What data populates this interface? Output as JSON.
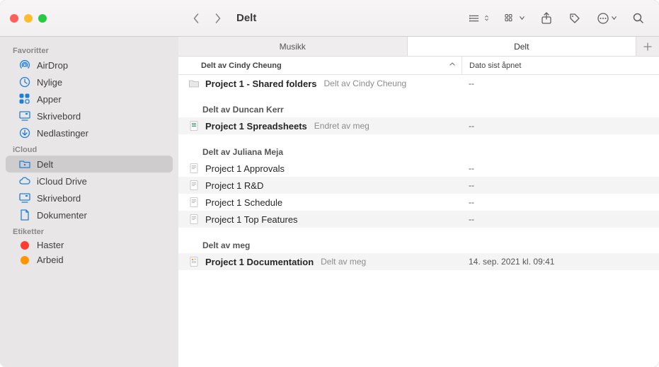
{
  "window_title": "Delt",
  "sidebar": {
    "sections": [
      {
        "header": "Favoritter",
        "items": [
          {
            "icon": "airdrop",
            "label": "AirDrop"
          },
          {
            "icon": "clock",
            "label": "Nylige"
          },
          {
            "icon": "apps",
            "label": "Apper"
          },
          {
            "icon": "desktop",
            "label": "Skrivebord"
          },
          {
            "icon": "download",
            "label": "Nedlastinger"
          }
        ]
      },
      {
        "header": "iCloud",
        "items": [
          {
            "icon": "shared-folder",
            "label": "Delt",
            "active": true
          },
          {
            "icon": "cloud",
            "label": "iCloud Drive"
          },
          {
            "icon": "desktop",
            "label": "Skrivebord"
          },
          {
            "icon": "doc",
            "label": "Dokumenter"
          }
        ]
      },
      {
        "header": "Etiketter",
        "tags": [
          {
            "color": "#ff3b30",
            "label": "Haster"
          },
          {
            "color": "#ff9500",
            "label": "Arbeid"
          }
        ]
      }
    ]
  },
  "tabs": [
    {
      "label": "Musikk",
      "active": false
    },
    {
      "label": "Delt",
      "active": true
    }
  ],
  "columns": {
    "name": "Delt av Cindy Cheung",
    "date": "Dato sist åpnet"
  },
  "groups": [
    {
      "header": "",
      "rows": [
        {
          "icon": "folder",
          "name": "Project 1 - Shared folders",
          "sub": "Delt av Cindy Cheung",
          "date": "--",
          "bold": true,
          "alt": false
        }
      ]
    },
    {
      "header": "Delt av Duncan Kerr",
      "rows": [
        {
          "icon": "sheet",
          "name": "Project 1 Spreadsheets",
          "sub": "Endret av meg",
          "date": "--",
          "bold": true,
          "alt": true
        }
      ]
    },
    {
      "header": "Delt av Juliana Meja",
      "rows": [
        {
          "icon": "doc",
          "name": "Project 1 Approvals",
          "sub": "",
          "date": "--",
          "bold": false,
          "alt": false
        },
        {
          "icon": "doc",
          "name": "Project 1 R&D",
          "sub": "",
          "date": "--",
          "bold": false,
          "alt": true
        },
        {
          "icon": "doc",
          "name": "Project 1 Schedule",
          "sub": "",
          "date": "--",
          "bold": false,
          "alt": false
        },
        {
          "icon": "doc",
          "name": "Project 1 Top Features",
          "sub": "",
          "date": "--",
          "bold": false,
          "alt": true
        }
      ]
    },
    {
      "header": "Delt av meg",
      "rows": [
        {
          "icon": "pages",
          "name": "Project 1 Documentation",
          "sub": "Delt av meg",
          "date": "14. sep. 2021 kl. 09:41",
          "bold": true,
          "alt": true
        }
      ]
    }
  ]
}
